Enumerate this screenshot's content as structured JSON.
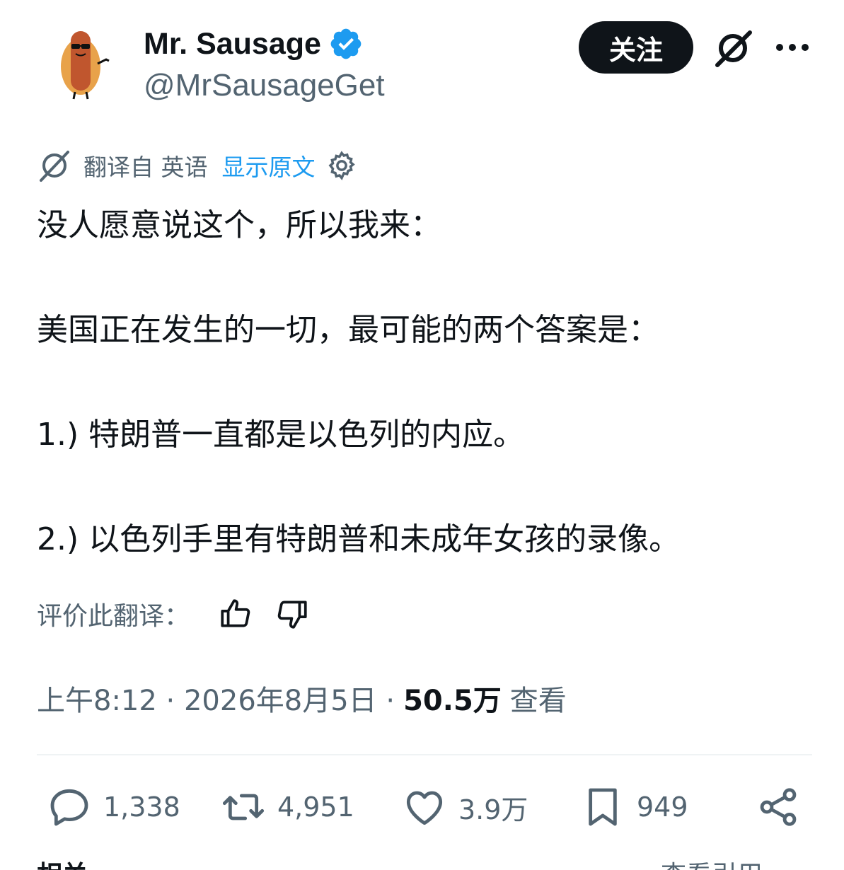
{
  "author": {
    "display_name": "Mr. Sausage",
    "handle": "@MrSausageGet",
    "avatar_icon": "hotdog-mascot-avatar",
    "verified_icon": "verified-badge-icon"
  },
  "header": {
    "follow_label": "关注",
    "grok_icon": "grok-icon",
    "more_icon": "more-icon"
  },
  "translation": {
    "from_label": "翻译自 英语",
    "show_original_label": "显示原文",
    "rate_label": "评价此翻译："
  },
  "tweet": {
    "line1": "没人愿意说这个，所以我来：",
    "line2": "美国正在发生的一切，最可能的两个答案是：",
    "line3": "1.) 特朗普一直都是以色列的内应。",
    "line4": "2.) 以色列手里有特朗普和未成年女孩的录像。"
  },
  "meta": {
    "time_date": "上午8:12 · 2026年8月5日 ·",
    "views_count": "50.5万",
    "views_label": "查看"
  },
  "actions": {
    "replies": "1,338",
    "retweets": "4,951",
    "likes": "3.9万",
    "bookmarks": "949"
  },
  "bottom": {
    "left_label": "相关",
    "right_label": "查看引用 ›"
  },
  "colors": {
    "text": "#0f1419",
    "secondary": "#536471",
    "link": "#1d9bf0",
    "verified": "#1d9bf0"
  }
}
